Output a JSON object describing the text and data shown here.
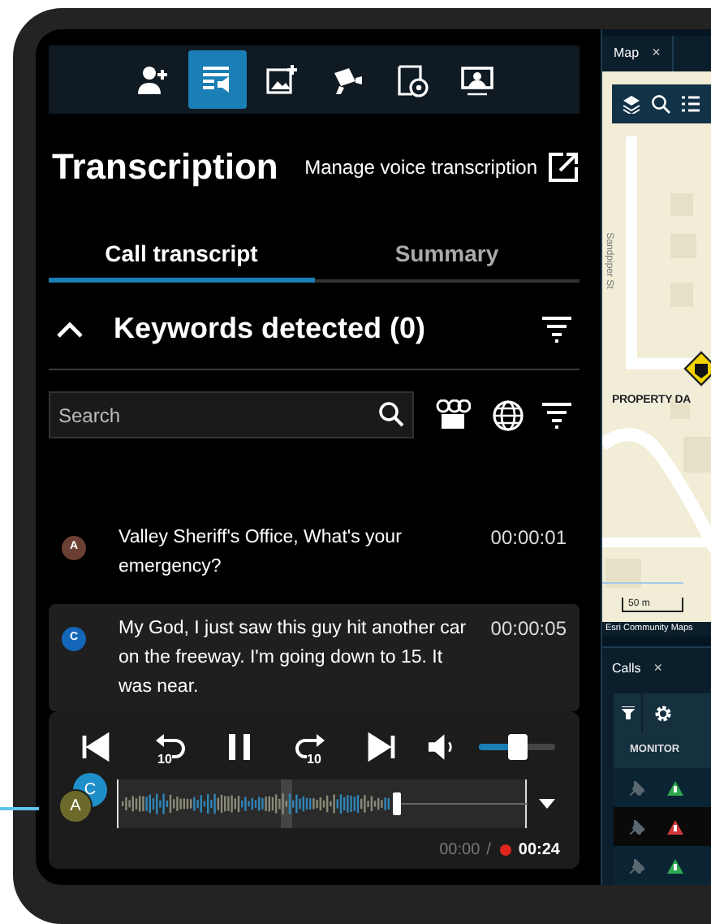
{
  "toolbar": [
    {
      "selected": false
    },
    {
      "selected": true
    },
    {
      "selected": false
    },
    {
      "selected": false
    },
    {
      "selected": false
    },
    {
      "selected": false
    }
  ],
  "title": "Transcription",
  "manage_link": "Manage voice transcription",
  "tabs": [
    {
      "label": "Call transcript",
      "selected": true
    },
    {
      "label": "Summary",
      "selected": false
    }
  ],
  "keywords": {
    "label": "Keywords detected (0)",
    "expanded": true
  },
  "search": {
    "placeholder": "Search"
  },
  "transcript": [
    {
      "speaker": "A",
      "color": "#6b3f33",
      "text": "Valley Sheriff's Office, What's your emergency?",
      "time": "00:00:01",
      "selected": false
    },
    {
      "speaker": "C",
      "color": "#1466b8",
      "text": "My God, I just saw this guy hit another car on the freeway. I'm going down to 15. It was near.",
      "time": "00:00:05",
      "selected": true
    }
  ],
  "player": {
    "rewind_label": "10",
    "forward_label": "10",
    "volume": {
      "level": 0.5
    },
    "progress": {
      "level": 0.68
    },
    "speakers": [
      {
        "label": "C",
        "color": "#1f8fc9"
      },
      {
        "label": "A",
        "color": "#6b6a2a"
      }
    ],
    "elapsed": "00:00",
    "separator": "/",
    "recording": true,
    "total": "00:24"
  },
  "map": {
    "tab": "Map",
    "close": "×",
    "street_label": "Sandpiper St",
    "place_label": "PROPERTY DA",
    "scale": "50 m",
    "attribution": "Esri Community Maps"
  },
  "calls": {
    "tab": "Calls",
    "close": "×",
    "column": "MONITOR",
    "rows": [
      {
        "color": "#2fa84f"
      },
      {
        "color": "#d03a3a"
      },
      {
        "color": "#2fa84f"
      }
    ]
  }
}
